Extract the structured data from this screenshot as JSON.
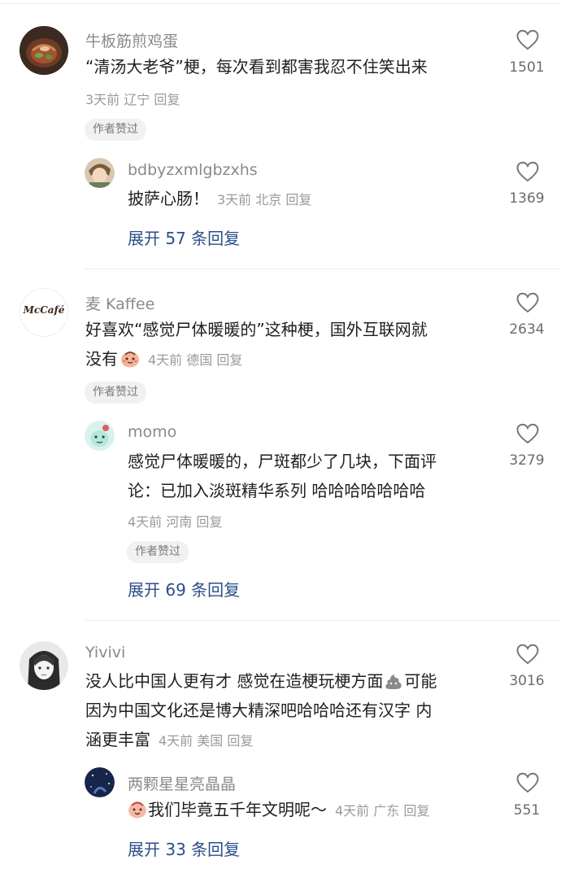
{
  "colors": {
    "link": "#2c4e86",
    "name": "#8a8a8a",
    "meta": "#9a9a9a",
    "badge_bg": "#f1f1f1"
  },
  "comments": [
    {
      "user": "牛板筋煎鸡蛋",
      "text": "“清汤大老爷”梗，每次看到都害我忍不住笑出来",
      "meta": "3天前 辽宁 回复",
      "likes": "1501",
      "badge": "作者赞过",
      "reply": {
        "user": "bdbyzxmlgbzxhs",
        "text": "披萨心肠！",
        "meta": "3天前 北京 回复",
        "likes": "1369"
      },
      "expand": "展开 57 条回复"
    },
    {
      "user": "麦 Kaffee",
      "text_line1": "好喜欢“感觉尸体暖暖的”这种梗，国外互联网就",
      "text_line2": "没有",
      "meta": "4天前 德国 回复",
      "likes": "2634",
      "badge": "作者赞过",
      "avatar_text": "McCafé",
      "reply": {
        "user": "momo",
        "text_line1": "感觉尸体暖暖的，尸斑都少了几块，下面评",
        "text_line2": "论：已加入淡斑精华系列 哈哈哈哈哈哈哈",
        "meta": "4天前 河南 回复",
        "likes": "3279",
        "badge": "作者赞过"
      },
      "expand": "展开 69 条回复"
    },
    {
      "user": "Yivivi",
      "text_line1a": "没人比中国人更有才 感觉在造梗玩梗方面",
      "text_line1b": "可能",
      "text_line2": "因为中国文化还是博大精深吧哈哈哈还有汉字 内",
      "text_line3": "涵更丰富",
      "meta": "4天前 美国 回复",
      "likes": "3016",
      "reply": {
        "user": "两颗星星亮晶晶",
        "text": "我们毕竟五千年文明呢～",
        "meta": "4天前 广东 回复",
        "likes": "551"
      },
      "expand": "展开 33 条回复"
    }
  ]
}
